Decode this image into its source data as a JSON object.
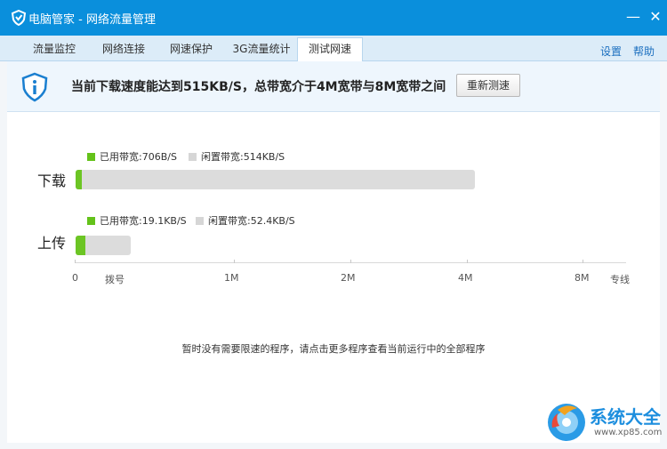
{
  "window": {
    "title": "电脑管家 - 网络流量管理",
    "minimize": "—",
    "close": "✕"
  },
  "tabs": [
    {
      "label": "流量监控"
    },
    {
      "label": "网络连接"
    },
    {
      "label": "网速保护"
    },
    {
      "label": "3G流量统计"
    },
    {
      "label": "测试网速",
      "active": true
    }
  ],
  "links": {
    "settings": "设置",
    "help": "帮助"
  },
  "banner": {
    "message": "当前下载速度能达到515KB/S，总带宽介于4M宽带与8M宽带之间",
    "retest_button": "重新测速"
  },
  "download": {
    "label": "下载",
    "used_legend": "已用带宽:706B/S",
    "idle_legend": "闲置带宽:514KB/S",
    "used_fraction": 0.015
  },
  "upload": {
    "label": "上传",
    "used_legend": "已用带宽:19.1KB/S",
    "idle_legend": "闲置带宽:52.4KB/S",
    "used_fraction": 0.18
  },
  "axis": {
    "ticks": [
      "0",
      "拨号",
      "1M",
      "2M",
      "4M",
      "8M",
      "专线"
    ]
  },
  "notice": "暂时没有需要限速的程序，请点击更多程序查看当前运行中的全部程序",
  "watermark": {
    "text": "系统大全",
    "url": "www.xp85.com"
  },
  "colors": {
    "titlebar": "#0a8fdc",
    "used": "#6cc524",
    "idle": "#dcdcdc"
  }
}
